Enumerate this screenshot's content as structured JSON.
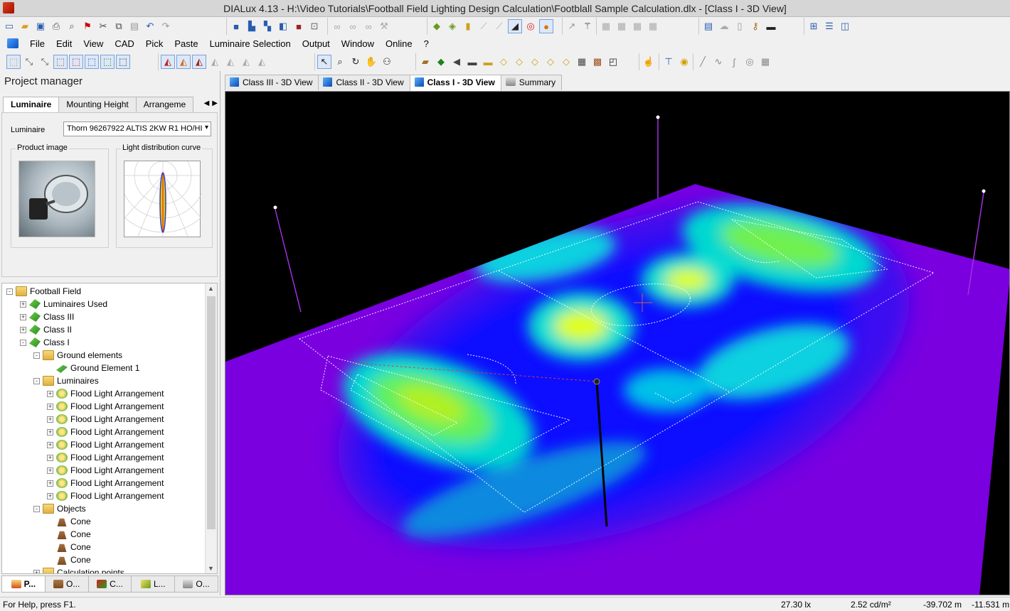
{
  "window": {
    "title": "DIALux 4.13 - H:\\Video Tutorials\\Football Field Lighting Design Calculation\\Footblall Sample Calculation.dlx - [Class I - 3D View]"
  },
  "menu": [
    {
      "label": "File"
    },
    {
      "label": "Edit"
    },
    {
      "label": "View"
    },
    {
      "label": "CAD"
    },
    {
      "label": "Pick"
    },
    {
      "label": "Paste"
    },
    {
      "label": "Luminaire Selection"
    },
    {
      "label": "Output"
    },
    {
      "label": "Window"
    },
    {
      "label": "Online"
    },
    {
      "label": "?"
    }
  ],
  "project_manager": {
    "title": "Project manager",
    "tabs": [
      "Luminaire",
      "Mounting Height",
      "Arrangeme"
    ],
    "luminaire_label": "Luminaire",
    "luminaire_value": "Thorn 96267922 ALTIS 2KW R1 HO/HI",
    "product_image_label": "Product image",
    "ldc_label": "Light distribution curve"
  },
  "tree": [
    {
      "label": "Football Field",
      "icon": "folder",
      "level": 0,
      "exp": "-"
    },
    {
      "label": "Luminaires Used",
      "icon": "green",
      "level": 1,
      "exp": "+"
    },
    {
      "label": "Class III",
      "icon": "green",
      "level": 1,
      "exp": "+"
    },
    {
      "label": "Class II",
      "icon": "green",
      "level": 1,
      "exp": "+"
    },
    {
      "label": "Class I",
      "icon": "green",
      "level": 1,
      "exp": "-"
    },
    {
      "label": "Ground elements",
      "icon": "folder",
      "level": 2,
      "exp": "-"
    },
    {
      "label": "Ground Element 1",
      "icon": "ground",
      "level": 3,
      "exp": ""
    },
    {
      "label": "Luminaires",
      "icon": "folder",
      "level": 2,
      "exp": "-"
    },
    {
      "label": "Flood Light Arrangement",
      "icon": "flood",
      "level": 3,
      "exp": "+"
    },
    {
      "label": "Flood Light Arrangement",
      "icon": "flood",
      "level": 3,
      "exp": "+"
    },
    {
      "label": "Flood Light Arrangement",
      "icon": "flood",
      "level": 3,
      "exp": "+"
    },
    {
      "label": "Flood Light Arrangement",
      "icon": "flood",
      "level": 3,
      "exp": "+"
    },
    {
      "label": "Flood Light Arrangement",
      "icon": "flood",
      "level": 3,
      "exp": "+"
    },
    {
      "label": "Flood Light Arrangement",
      "icon": "flood",
      "level": 3,
      "exp": "+"
    },
    {
      "label": "Flood Light Arrangement",
      "icon": "flood",
      "level": 3,
      "exp": "+"
    },
    {
      "label": "Flood Light Arrangement",
      "icon": "flood",
      "level": 3,
      "exp": "+"
    },
    {
      "label": "Flood Light Arrangement",
      "icon": "flood",
      "level": 3,
      "exp": "+"
    },
    {
      "label": "Objects",
      "icon": "folder",
      "level": 2,
      "exp": "-"
    },
    {
      "label": "Cone",
      "icon": "cone",
      "level": 3,
      "exp": ""
    },
    {
      "label": "Cone",
      "icon": "cone",
      "level": 3,
      "exp": ""
    },
    {
      "label": "Cone",
      "icon": "cone",
      "level": 3,
      "exp": ""
    },
    {
      "label": "Cone",
      "icon": "cone",
      "level": 3,
      "exp": ""
    },
    {
      "label": "Calculation points",
      "icon": "folder",
      "level": 2,
      "exp": "+"
    }
  ],
  "bottom_tabs": [
    "P...",
    "O...",
    "C...",
    "L...",
    "O..."
  ],
  "view_tabs": [
    {
      "label": "Class III - 3D View",
      "icon": "cube"
    },
    {
      "label": "Class II - 3D View",
      "icon": "cube"
    },
    {
      "label": "Class I - 3D View",
      "icon": "cube"
    },
    {
      "label": "Summary",
      "icon": "printer"
    }
  ],
  "status": {
    "help": "For Help, press F1.",
    "illuminance": "27.30 lx",
    "luminance": "2.52 cd/m²",
    "x": "-39.702 m",
    "y": "-11.531 m"
  },
  "colors": {
    "falsecolor_low": "#8a00ff",
    "falsecolor_mid": "#1010ff",
    "falsecolor_high": "#e8ff00"
  }
}
